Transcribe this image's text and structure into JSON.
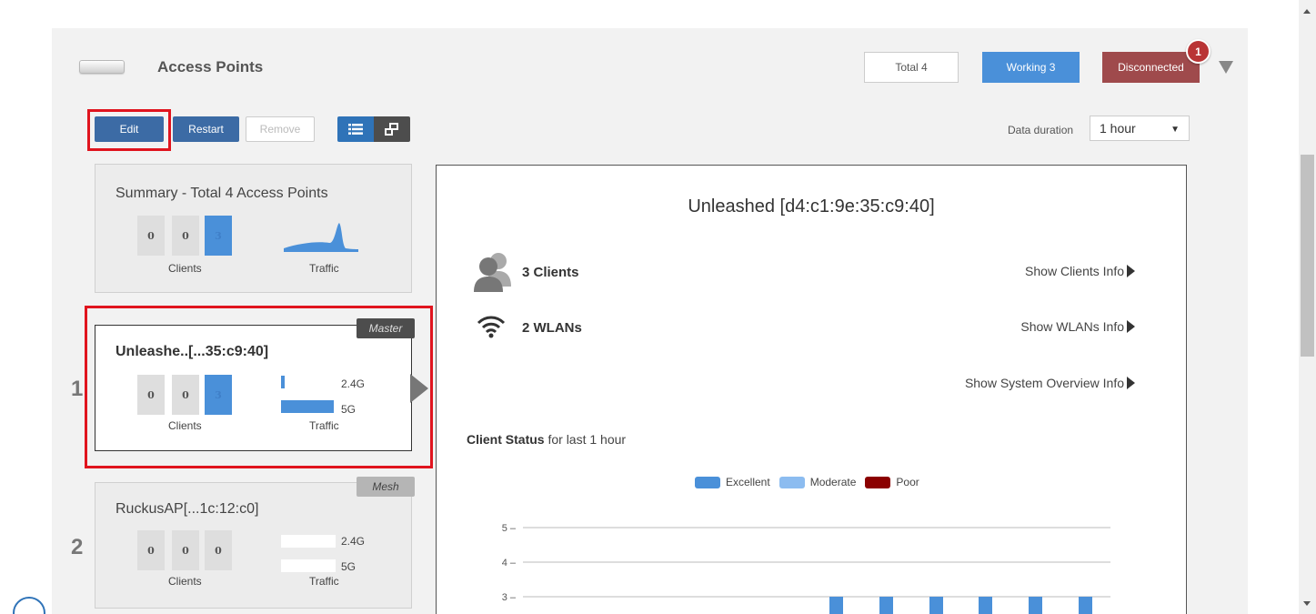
{
  "header": {
    "title": "Access Points",
    "total_label": "Total 4",
    "working_label": "Working 3",
    "disconnected_label": "Disconnected",
    "notification_count": "1"
  },
  "toolbar": {
    "edit_label": "Edit",
    "restart_label": "Restart",
    "remove_label": "Remove",
    "duration_label": "Data duration",
    "duration_value": "1 hour"
  },
  "summary": {
    "title": "Summary - Total 4 Access Points",
    "counts": [
      "0",
      "0",
      "3"
    ],
    "clients_label": "Clients",
    "traffic_label": "Traffic"
  },
  "aps": [
    {
      "index": "1",
      "name": "Unleashe..[...35:c9:40]",
      "role": "Master",
      "counts": [
        "0",
        "0",
        "3"
      ],
      "clients_label": "Clients",
      "traffic_label": "Traffic",
      "band_24": "2.4G",
      "band_5": "5G",
      "traffic_24_fraction": 0.07,
      "traffic_5_fraction": 1.0
    },
    {
      "index": "2",
      "name": "RuckusAP[...1c:12:c0]",
      "role": "Mesh",
      "counts": [
        "0",
        "0",
        "0"
      ],
      "clients_label": "Clients",
      "traffic_label": "Traffic",
      "band_24": "2.4G",
      "band_5": "5G",
      "traffic_24_fraction": 0,
      "traffic_5_fraction": 0
    }
  ],
  "detail": {
    "title": "Unleashed [d4:c1:9e:35:c9:40]",
    "clients_metric": "3 Clients",
    "wlans_metric": "2 WLANs",
    "show_clients": "Show Clients Info",
    "show_wlans": "Show WLANs Info",
    "show_system": "Show System Overview Info",
    "client_status_bold": "Client Status",
    "client_status_rest": " for last 1 hour",
    "legend": {
      "excellent": "Excellent",
      "moderate": "Moderate",
      "poor": "Poor"
    }
  },
  "colors": {
    "excellent": "#4a90d9",
    "moderate": "#8cbcf0",
    "poor": "#8b0000"
  },
  "chart_data": {
    "type": "bar",
    "title": "",
    "xlabel": "",
    "ylabel": "",
    "y_ticks": [
      "5",
      "4",
      "3"
    ],
    "ylim": [
      3,
      5
    ],
    "bar_count_visible": 6,
    "series": [
      {
        "name": "Excellent",
        "values": [
          3,
          3,
          3,
          3,
          3,
          3
        ]
      }
    ],
    "legend_position": "top-center",
    "grid": true
  }
}
